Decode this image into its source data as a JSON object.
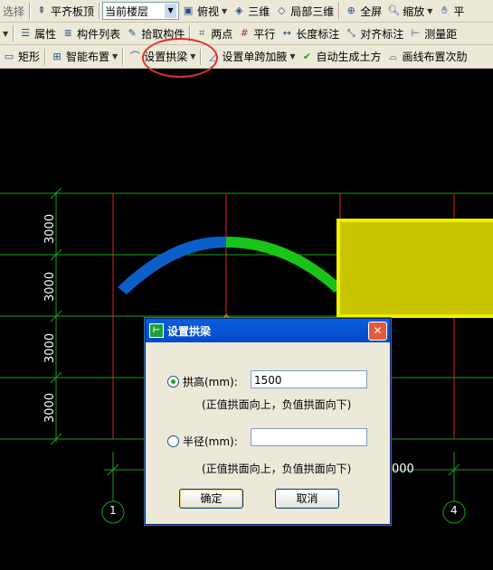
{
  "toolbar_row1": {
    "select_label": "选择",
    "align_top": "平齐板顶",
    "floor_combo": "当前楼层",
    "top_view": "俯视",
    "view_3d": "三维",
    "local_3d": "局部三维",
    "fullscreen": "全屏",
    "zoom": "缩放",
    "pan": "平"
  },
  "toolbar_row2": {
    "properties": "属性",
    "component_list": "构件列表",
    "pick_component": "拾取构件",
    "two_points": "两点",
    "parallel": "平行",
    "length_dim": "长度标注",
    "align_dim": "对齐标注",
    "measure": "测量距"
  },
  "toolbar_row3": {
    "rectangle": "矩形",
    "smart_layout": "智能布置",
    "set_arch_beam": "设置拱梁",
    "set_single_span": "设置单跨加腋",
    "auto_earthwork": "自动生成土方",
    "draw_line_layout": "画线布置次肋"
  },
  "canvas": {
    "dims": [
      "3000",
      "3000",
      "3000",
      "3000"
    ],
    "bottom_dim": "000",
    "axis_1": "1",
    "axis_4": "4",
    "colors": {
      "grid_red": "#e02020",
      "grid_green": "#1aa01a",
      "arch_blue": "#0a60c8",
      "arch_green": "#18c418",
      "slab_yellow": "#c8c400",
      "slab_border": "#f0f000"
    }
  },
  "dialog": {
    "title": "设置拱梁",
    "close_icon": "close-icon",
    "arch_height_label": "拱高(mm):",
    "arch_height_value": "1500",
    "arch_height_selected": true,
    "hint_1": "(正值拱面向上，负值拱面向下)",
    "radius_label": "半径(mm):",
    "radius_value": "",
    "hint_2": "(正值拱面向上，负值拱面向下)",
    "ok_label": "确定",
    "cancel_label": "取消"
  }
}
